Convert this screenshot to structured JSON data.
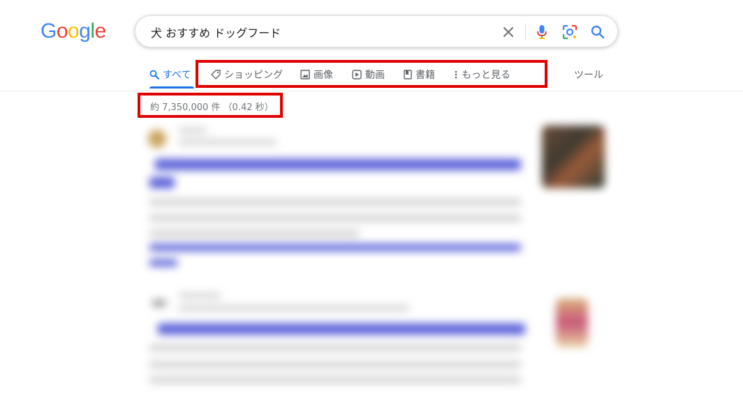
{
  "logo": {
    "letters": [
      "G",
      "o",
      "o",
      "g",
      "l",
      "e"
    ],
    "colors": [
      "#4285f4",
      "#ea4335",
      "#fbbc05",
      "#4285f4",
      "#34a853",
      "#ea4335"
    ]
  },
  "search": {
    "query": "犬 おすすめ ドッグフード",
    "clear_icon": "close-icon",
    "voice_icon": "mic-icon",
    "lens_icon": "lens-icon",
    "search_icon": "search-icon"
  },
  "tabs": {
    "all": "すべて",
    "shopping": "ショッピング",
    "images": "画像",
    "videos": "動画",
    "books": "書籍",
    "more": "もっと見る",
    "tools": "ツール"
  },
  "result_count": "約 7,350,000 件 （0.42 秒）",
  "colors": {
    "accent": "#1a73e8",
    "highlight": "#e00000",
    "muted": "#70757a"
  }
}
